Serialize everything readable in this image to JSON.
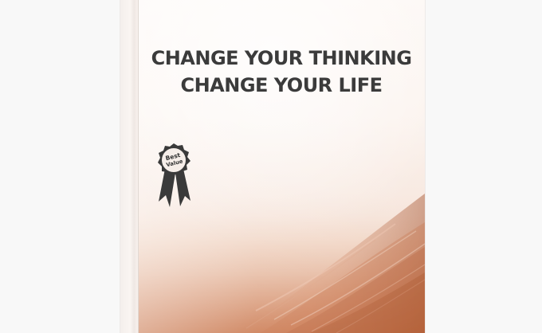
{
  "book": {
    "title_line_1": "CHANGE YOUR THINKING",
    "title_line_2": "CHANGE YOUR LIFE"
  },
  "badge": {
    "line_1": "Best",
    "line_2": "Value"
  },
  "colors": {
    "background": "#f8f8f8",
    "cover": "#fbf2ed",
    "title_text": "#3b3b3b",
    "wood_light": "#e8b08f",
    "wood_dark": "#b35f38",
    "badge": "#3a3a3a"
  }
}
